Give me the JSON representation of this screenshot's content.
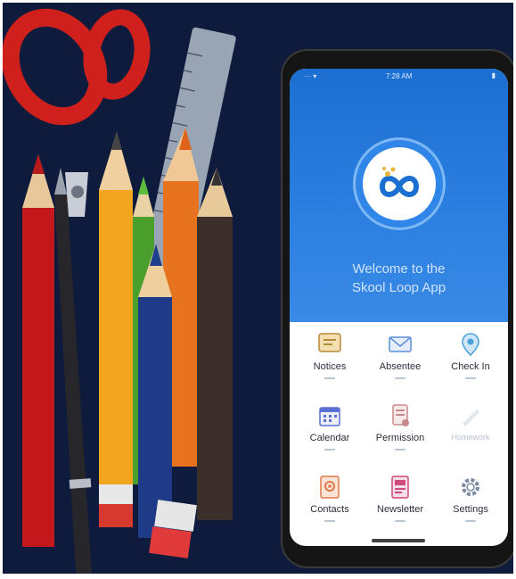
{
  "phone": {
    "status_bar": {
      "left": "··· ▾",
      "time": "7:28 AM",
      "right": "▮"
    },
    "welcome_line1": "Welcome to the",
    "welcome_line2": "Skool Loop App",
    "menu": [
      {
        "label": "Notices",
        "icon": "notices-icon",
        "color": "#d9a441"
      },
      {
        "label": "Absentee",
        "icon": "envelope-icon",
        "color": "#5a8fd6"
      },
      {
        "label": "Check In",
        "icon": "location-pin-icon",
        "color": "#4aa0d8"
      },
      {
        "label": "Calendar",
        "icon": "calendar-icon",
        "color": "#5a6fd6"
      },
      {
        "label": "Permission",
        "icon": "permission-icon",
        "color": "#c98a8a"
      },
      {
        "label": "Homework",
        "icon": "homework-icon",
        "color": "#c7d0dc"
      },
      {
        "label": "Contacts",
        "icon": "contacts-icon",
        "color": "#e0794a"
      },
      {
        "label": "Newsletter",
        "icon": "newsletter-icon",
        "color": "#d04a7a"
      },
      {
        "label": "Settings",
        "icon": "gear-icon",
        "color": "#7b8aa0"
      }
    ]
  },
  "colors": {
    "background": "#0f1b3d",
    "hero_blue": "#1f73d6",
    "logo_blue": "#2f86e8",
    "logo_gold": "#e7b63a"
  }
}
